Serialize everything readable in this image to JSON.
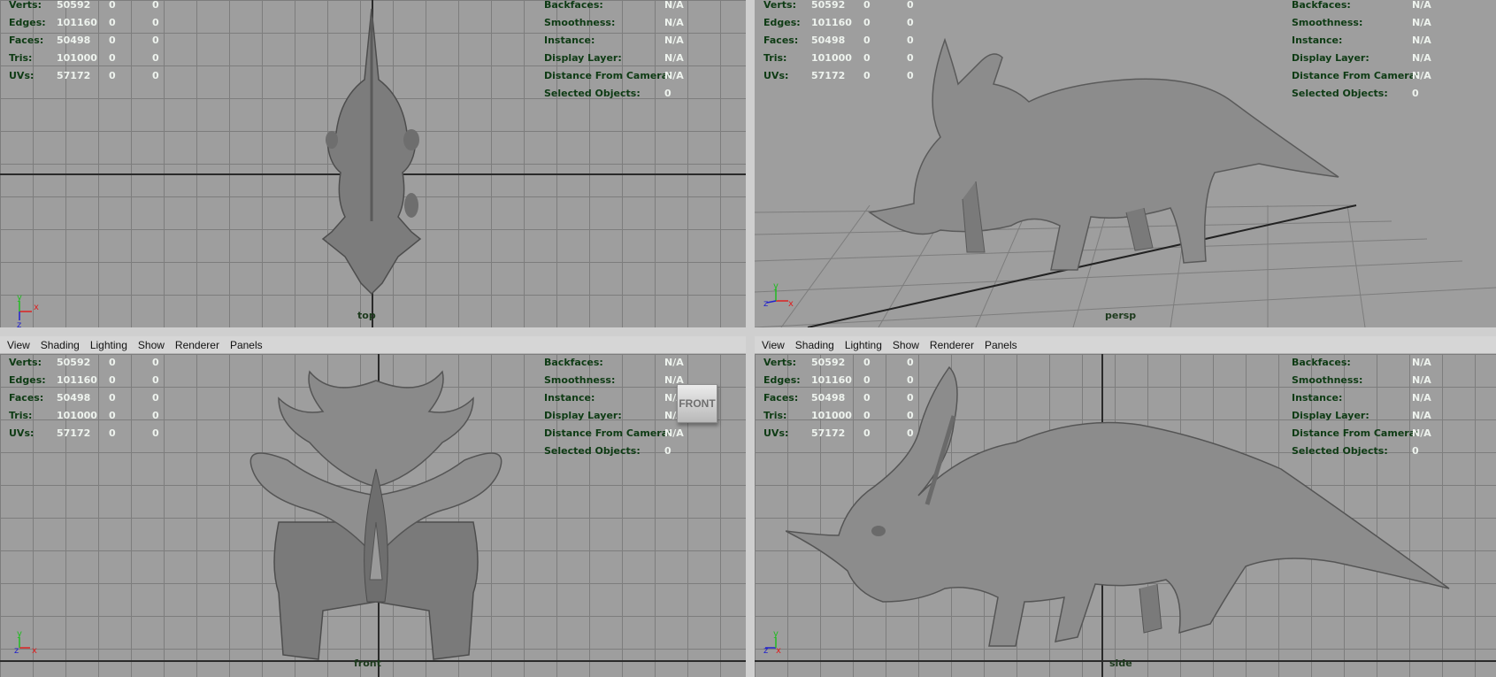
{
  "menu": [
    "View",
    "Shading",
    "Lighting",
    "Show",
    "Renderer",
    "Panels"
  ],
  "hud_left": [
    {
      "label": "Verts:",
      "v1": "50592",
      "v2": "0",
      "v3": "0"
    },
    {
      "label": "Edges:",
      "v1": "101160",
      "v2": "0",
      "v3": "0"
    },
    {
      "label": "Faces:",
      "v1": "50498",
      "v2": "0",
      "v3": "0"
    },
    {
      "label": "Tris:",
      "v1": "101000",
      "v2": "0",
      "v3": "0"
    },
    {
      "label": "UVs:",
      "v1": "57172",
      "v2": "0",
      "v3": "0"
    }
  ],
  "hud_right": [
    {
      "label": "Backfaces:",
      "value": "N/A"
    },
    {
      "label": "Smoothness:",
      "value": "N/A"
    },
    {
      "label": "Instance:",
      "value": "N/A"
    },
    {
      "label": "Display Layer:",
      "value": "N/A"
    },
    {
      "label": "Distance From Camera:",
      "value": "N/A"
    },
    {
      "label": "Selected Objects:",
      "value": "0"
    }
  ],
  "cameras": {
    "top": "top",
    "persp": "persp",
    "front": "front",
    "side": "side"
  },
  "viewcube_label": "FRONT",
  "axes": {
    "x": "x",
    "y": "y",
    "z": "z"
  },
  "colors": {
    "viewport_bg": "#9e9e9e",
    "hud_label": "#0e3b14",
    "hud_value": "#eef3ee",
    "model": "#8a8a8a"
  }
}
